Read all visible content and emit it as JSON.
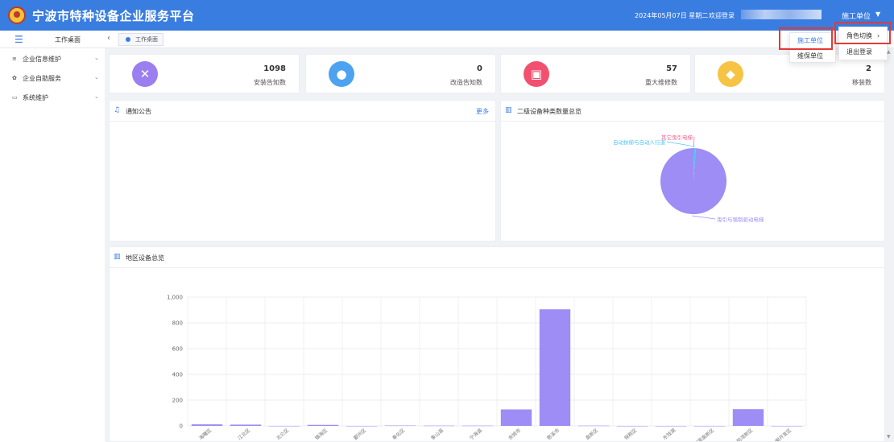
{
  "app": {
    "title": "宁波市特种设备企业服务平台"
  },
  "header": {
    "date": "2024年05月07日 星期二",
    "welcome": "欢迎登录",
    "role": "施工单位",
    "caret": "▼"
  },
  "nav": {
    "title": "工作桌面",
    "tab": "工作桌面",
    "toggle_icon": "☰",
    "back_icon": "‹"
  },
  "sidebar": {
    "items": [
      {
        "label": "企业信息维护",
        "icon": "database-icon",
        "glyph": "≡",
        "caret": "⌄"
      },
      {
        "label": "企业自助服务",
        "icon": "gear-icon",
        "glyph": "✿",
        "caret": "⌄"
      },
      {
        "label": "系统维护",
        "icon": "monitor-icon",
        "glyph": "▭",
        "caret": "⌄"
      }
    ]
  },
  "stats": [
    {
      "value": "1098",
      "label": "安装告知数",
      "icon": "tools-icon",
      "glyph": "✕",
      "color": "#9b7ef0"
    },
    {
      "value": "0",
      "label": "改造告知数",
      "icon": "bulb-icon",
      "glyph": "●",
      "color": "#4da3ef"
    },
    {
      "value": "57",
      "label": "重大维修数",
      "icon": "calendar-icon",
      "glyph": "▣",
      "color": "#f2506f"
    },
    {
      "value": "2",
      "label": "移装数",
      "icon": "badge-icon",
      "glyph": "◆",
      "color": "#f6c344"
    }
  ],
  "notice": {
    "title": "通知公告",
    "more": "更多",
    "icon": "bell-icon",
    "glyph": "♫"
  },
  "pie_panel": {
    "title": "二级设备种类数量总览",
    "icon": "bar-chart-icon",
    "glyph": "▥"
  },
  "bar_panel": {
    "title": "地区设备总览",
    "icon": "bar-chart-icon",
    "glyph": "▥"
  },
  "dropdowns": {
    "role_menu": {
      "items": [
        "角色切换",
        "退出登录"
      ],
      "caret": "›"
    },
    "role_submenu": {
      "items": [
        "施工单位",
        "维保单位"
      ]
    }
  },
  "colors": {
    "header": "#3a7de0",
    "accent": "#3a7de0",
    "bar": "#9d8df5",
    "highlight": "#e53935"
  },
  "chart_data": [
    {
      "type": "pie",
      "labels": [
        "其它曳引电梯",
        "自动扶梯与自动人行道",
        "曳引与强制驱动电梯"
      ],
      "values": [
        2,
        10,
        1000
      ]
    },
    {
      "type": "bar",
      "categories": [
        "海曙区",
        "江北区",
        "北仑区",
        "镇海区",
        "鄞州区",
        "奉化区",
        "象山县",
        "宁海县",
        "余姚市",
        "慈溪市",
        "高新区",
        "保税区",
        "东钱湖",
        "国家高新区",
        "前湾新区",
        "大榭开发区"
      ],
      "values": [
        12,
        10,
        0,
        8,
        0,
        3,
        2,
        2,
        128,
        905,
        2,
        0,
        0,
        0,
        130,
        0
      ],
      "ylim": [
        0,
        1000
      ],
      "yticks": [
        0,
        200,
        400,
        600,
        800,
        1000
      ],
      "ytick_labels": [
        "0",
        "200",
        "400",
        "600",
        "800",
        "1,000"
      ],
      "grid": true
    }
  ]
}
